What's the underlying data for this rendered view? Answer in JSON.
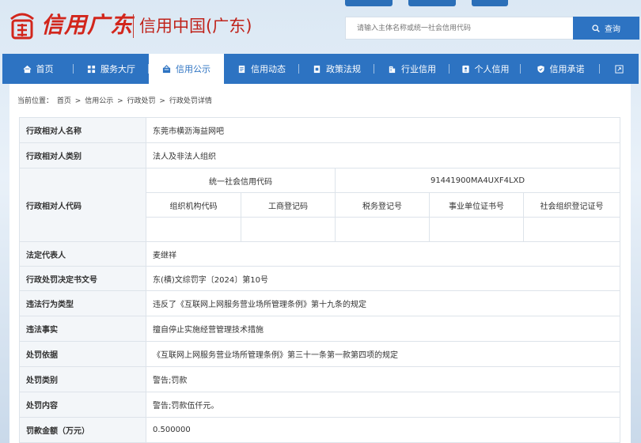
{
  "header": {
    "logo_script": "信用广东",
    "logo_cn": "信用中国(广东)",
    "search_placeholder": "请输入主体名称或统一社会信用代码",
    "search_button": "查询"
  },
  "nav": {
    "items": [
      {
        "label": "首页",
        "icon": "home-icon"
      },
      {
        "label": "服务大厅",
        "icon": "grid-icon"
      },
      {
        "label": "信用公示",
        "icon": "announce-icon",
        "active": true
      },
      {
        "label": "信用动态",
        "icon": "news-icon"
      },
      {
        "label": "政策法规",
        "icon": "policy-icon"
      },
      {
        "label": "行业信用",
        "icon": "building-icon"
      },
      {
        "label": "个人信用",
        "icon": "id-card-icon"
      },
      {
        "label": "信用承诺",
        "icon": "shield-icon"
      }
    ],
    "expand_icon": "expand-icon"
  },
  "breadcrumb": {
    "prefix": "当前位置：",
    "items": [
      "首页",
      "信用公示",
      "行政处罚",
      "行政处罚详情"
    ],
    "separator": ">"
  },
  "detail": {
    "name_label": "行政相对人名称",
    "name_value": "东莞市横沥海益网吧",
    "type_label": "行政相对人类别",
    "type_value": "法人及非法人组织",
    "code_label": "行政相对人代码",
    "uscc_label": "统一社会信用代码",
    "uscc_value": "91441900MA4UXF4LXD",
    "sub_headers": [
      "组织机构代码",
      "工商登记码",
      "税务登记号",
      "事业单位证书号",
      "社会组织登记证号"
    ],
    "sub_values": [
      "",
      "",
      "",
      "",
      ""
    ],
    "legal_label": "法定代表人",
    "legal_value": "麦继祥",
    "doc_label": "行政处罚决定书文号",
    "doc_value": "东(横)文综罚字〔2024〕第10号",
    "violation_type_label": "违法行为类型",
    "violation_type_value": "违反了《互联网上网服务营业场所管理条例》第十九条的规定",
    "facts_label": "违法事实",
    "facts_value": "擅自停止实施经营管理技术措施",
    "basis_label": "处罚依据",
    "basis_value": "《互联网上网服务营业场所管理条例》第三十一条第一款第四项的规定",
    "category_label": "处罚类别",
    "category_value": "警告;罚款",
    "content_label": "处罚内容",
    "content_value": "警告;罚款伍仟元。",
    "amount_label": "罚款金额（万元）",
    "amount_value": "0.500000"
  },
  "colors": {
    "primary": "#2d73c2",
    "brand_red": "#d2261c",
    "label_bg": "#f3f6f9",
    "border": "#dde3ea"
  }
}
